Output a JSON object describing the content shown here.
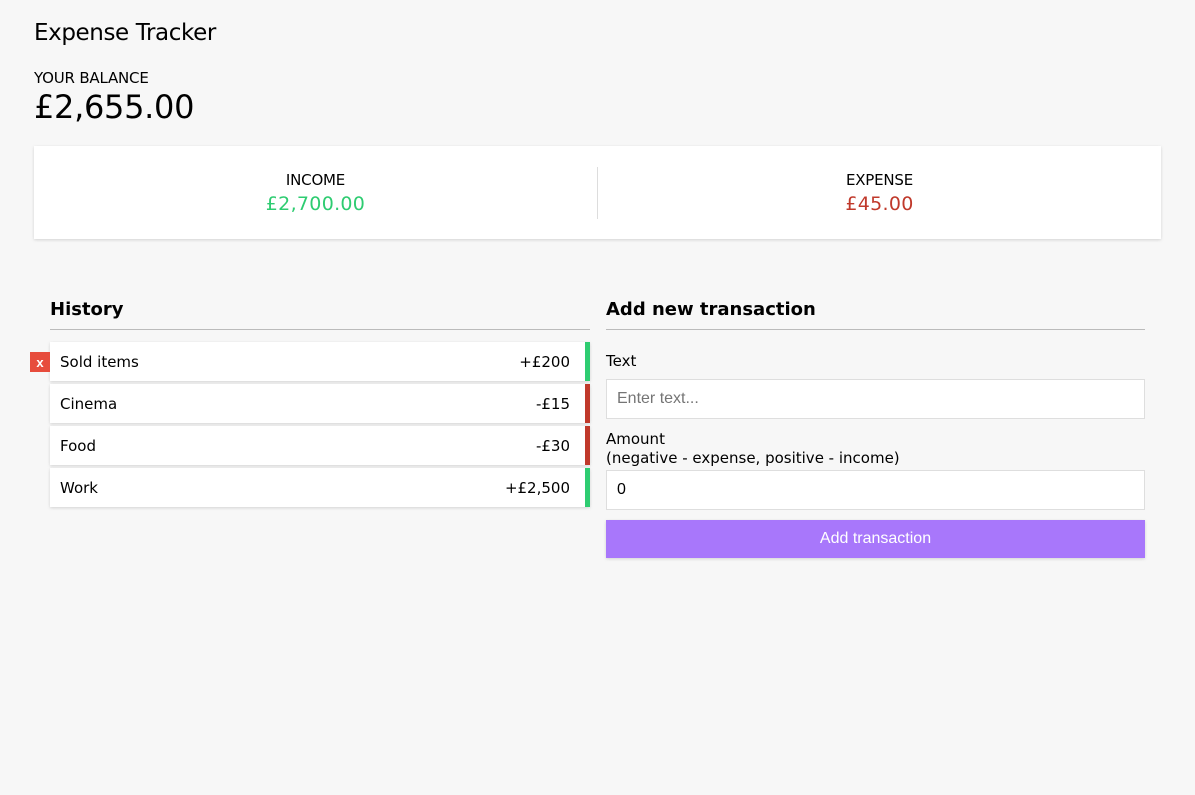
{
  "header": {
    "title": "Expense Tracker",
    "balance_label": "YOUR BALANCE",
    "balance_value": "£2,655.00"
  },
  "summary": {
    "income_label": "INCOME",
    "income_value": "£2,700.00",
    "expense_label": "EXPENSE",
    "expense_value": "£45.00",
    "income_color": "#2ecc71",
    "expense_color": "#c0392b"
  },
  "history": {
    "title": "History",
    "delete_label": "x",
    "items": [
      {
        "text": "Sold items",
        "amount": "+£200",
        "type": "plus"
      },
      {
        "text": "Cinema",
        "amount": "-£15",
        "type": "minus"
      },
      {
        "text": "Food",
        "amount": "-£30",
        "type": "minus"
      },
      {
        "text": "Work",
        "amount": "+£2,500",
        "type": "plus"
      }
    ]
  },
  "form": {
    "title": "Add new transaction",
    "text_label": "Text",
    "text_placeholder": "Enter text...",
    "text_value": "",
    "amount_label": "Amount",
    "amount_hint": "(negative - expense, positive - income)",
    "amount_value": "0",
    "submit_label": "Add transaction",
    "submit_color": "#a877fb"
  }
}
